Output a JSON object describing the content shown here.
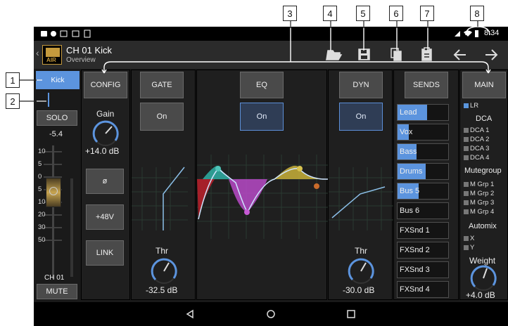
{
  "callouts": {
    "c1": "1",
    "c2": "2",
    "c3": "3",
    "c4": "4",
    "c5": "5",
    "c6": "6",
    "c7": "7",
    "c8": "8"
  },
  "status": {
    "time": "8:34"
  },
  "header": {
    "title": "CH 01 Kick",
    "subtitle": "Overview",
    "logo_text": "AIR"
  },
  "toolbar_icons": [
    "folder-open-icon",
    "save-icon",
    "copy-icon",
    "paste-icon",
    "back-arrow-icon",
    "forward-arrow-icon"
  ],
  "channel": {
    "name_button": "Kick",
    "solo": "SOLO",
    "level": "-5.4",
    "scale": [
      "10",
      "5",
      "0",
      "5",
      "10",
      "20",
      "30",
      "50"
    ],
    "fader_level_db": -5.4,
    "label": "CH 01",
    "mute": "MUTE"
  },
  "config": {
    "tab": "CONFIG",
    "gain_label": "Gain",
    "gain_value": "+14.0 dB",
    "phase": "ø",
    "phantom": "+48V",
    "link": "LINK"
  },
  "gate": {
    "tab": "GATE",
    "toggle": "On",
    "thr_label": "Thr",
    "thr_value": "-32.5 dB"
  },
  "eq": {
    "tab": "EQ",
    "toggle": "On"
  },
  "dyn": {
    "tab": "DYN",
    "toggle": "On",
    "thr_label": "Thr",
    "thr_value": "-30.0 dB"
  },
  "sends": {
    "tab": "SENDS",
    "items": [
      {
        "label": "Lead",
        "level": 0.58
      },
      {
        "label": "Vox",
        "level": 0.22
      },
      {
        "label": "Bass",
        "level": 0.38
      },
      {
        "label": "Drums",
        "level": 0.56
      },
      {
        "label": "Bus 5",
        "level": 0.42
      },
      {
        "label": "Bus 6",
        "level": 0
      },
      {
        "label": "FXSnd 1",
        "level": 0
      },
      {
        "label": "FXSnd 2",
        "level": 0
      },
      {
        "label": "FXSnd 3",
        "level": 0
      },
      {
        "label": "FXSnd 4",
        "level": 0
      }
    ]
  },
  "main": {
    "tab": "MAIN",
    "lr": "LR",
    "dca_title": "DCA",
    "dca": [
      "DCA 1",
      "DCA 2",
      "DCA 3",
      "DCA 4"
    ],
    "mutegroup_title": "Mutegroup",
    "mutegroups": [
      "M Grp 1",
      "M Grp 2",
      "M Grp 3",
      "M Grp 4"
    ],
    "automix_title": "Automix",
    "automix": [
      "X",
      "Y"
    ],
    "weight_label": "Weight",
    "weight_value": "+4.0 dB"
  },
  "colors": {
    "accent": "#5c94de",
    "panel": "#1f1f1f",
    "button": "#4a4a4a"
  }
}
